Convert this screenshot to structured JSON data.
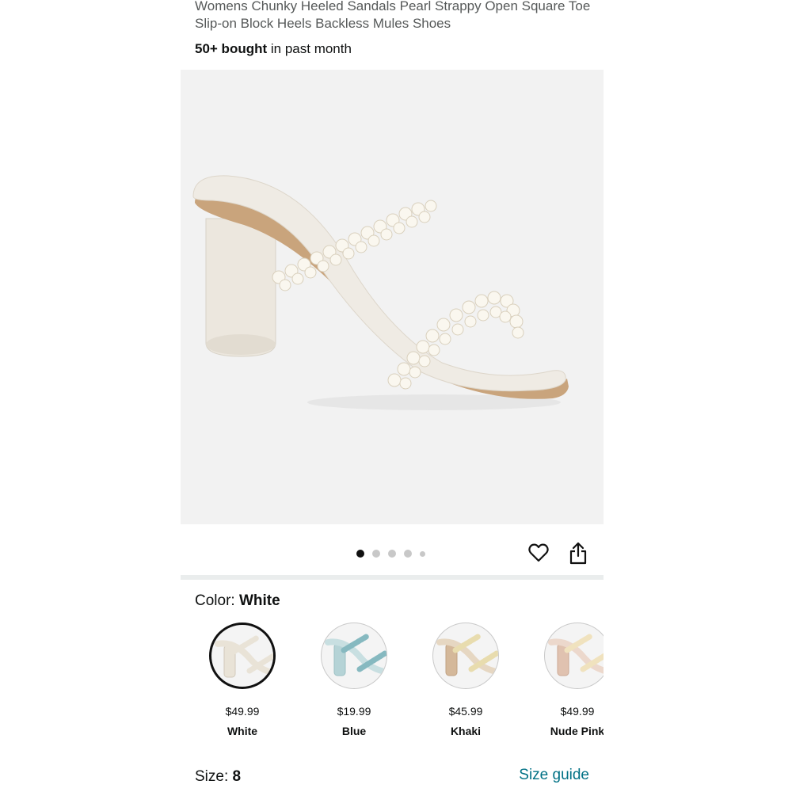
{
  "product": {
    "title": "Womens Chunky Heeled Sandals Pearl Strappy Open Square Toe Slip-on Block Heels Backless Mules Shoes",
    "bought_count": "50+ bought",
    "bought_suffix": " in past month"
  },
  "gallery": {
    "image_count": 5,
    "active_index": 0
  },
  "actions": {
    "favorite_icon": "heart-outline-icon",
    "share_icon": "share-icon"
  },
  "color": {
    "label": "Color: ",
    "selected": "White",
    "options": [
      {
        "price": "$49.99",
        "name": "White",
        "strap_color": "#e9e3d7",
        "heel_color": "#e9e3d7"
      },
      {
        "price": "$19.99",
        "name": "Blue",
        "strap_color": "#86b9c0",
        "heel_color": "#b5d3d6"
      },
      {
        "price": "$45.99",
        "name": "Khaki",
        "strap_color": "#e8dcae",
        "heel_color": "#d4b89a"
      },
      {
        "price": "$49.99",
        "name": "Nude Pink",
        "strap_color": "#f0e2be",
        "heel_color": "#e0c2b0"
      }
    ]
  },
  "size": {
    "label": "Size: ",
    "value": "8",
    "guide_label": "Size guide"
  },
  "colors": {
    "link": "#007185",
    "hero_bg": "#f2f2f2",
    "divider": "#eaeded"
  }
}
